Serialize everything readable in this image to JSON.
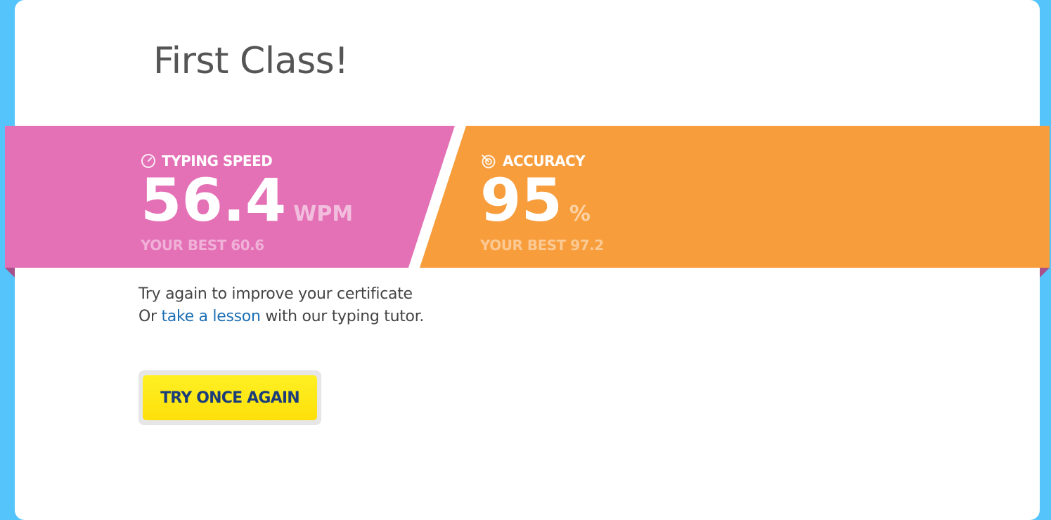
{
  "title": "First Class!",
  "colors": {
    "page_background": "#55c4fb",
    "speed_panel": "#e470b6",
    "accuracy_panel": "#f89d3b",
    "button": "#ffea1a",
    "button_text": "#1c3d7a",
    "link": "#1e6fb4"
  },
  "speed": {
    "icon": "speedometer-icon",
    "label": "TYPING SPEED",
    "value": "56.4",
    "unit": "WPM",
    "best": "YOUR BEST 60.6"
  },
  "accuracy": {
    "icon": "target-icon",
    "label": "ACCURACY",
    "value": "95",
    "unit": "%",
    "best": "YOUR BEST 97.2"
  },
  "message": {
    "line1": "Try again to improve your certificate",
    "line2_prefix": "Or ",
    "link_text": "take a lesson",
    "line2_suffix": " with our typing tutor."
  },
  "button": {
    "label": "TRY ONCE AGAIN"
  }
}
